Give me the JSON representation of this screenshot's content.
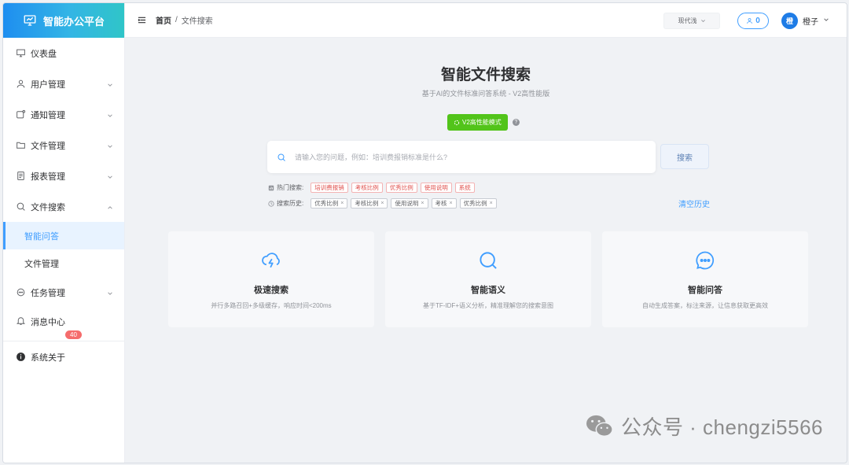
{
  "app": {
    "title": "智能办公平台"
  },
  "sidebar": {
    "items": [
      {
        "label": "仪表盘",
        "icon": "dashboard-icon"
      },
      {
        "label": "用户管理",
        "icon": "user-icon"
      },
      {
        "label": "通知管理",
        "icon": "notification-icon"
      },
      {
        "label": "文件管理",
        "icon": "folder-icon"
      },
      {
        "label": "报表管理",
        "icon": "report-icon"
      },
      {
        "label": "文件搜索",
        "icon": "search-icon"
      }
    ],
    "sub_items": [
      {
        "label": "智能问答",
        "active": true
      },
      {
        "label": "文件管理",
        "active": false
      }
    ],
    "tasks": {
      "label": "任务管理",
      "icon": "chat-icon"
    },
    "messages": {
      "label": "消息中心",
      "icon": "bell-icon",
      "badge": "40"
    },
    "about": {
      "label": "系统关于",
      "icon": "info-icon"
    }
  },
  "header": {
    "breadcrumb": {
      "home": "首页",
      "separator": "/",
      "current": "文件搜索"
    },
    "theme": "现代浅",
    "notif_count": "0",
    "user": {
      "avatar_char": "橙",
      "name": "橙子"
    }
  },
  "main": {
    "title": "智能文件搜索",
    "subtitle": "基于AI的文件标准问答系统 - V2高性能版",
    "mode_button": "V2高性能模式",
    "help": "?",
    "search": {
      "placeholder": "请输入您的问题，例如：培训费报销标准是什么?",
      "button": "搜索"
    },
    "hot": {
      "label": "热门搜索:",
      "tags": [
        "培训费报销",
        "考核比例",
        "优秀比例",
        "使用说明",
        "系统"
      ]
    },
    "history": {
      "label": "搜索历史:",
      "tags": [
        "优秀比例",
        "考核比例",
        "使用说明",
        "考核",
        "优秀比例"
      ]
    },
    "clear": "清空历史",
    "cards": [
      {
        "icon": "lightning-cloud-icon",
        "title": "极速搜索",
        "desc": "并行多路召回+多级缓存，响应时间<200ms"
      },
      {
        "icon": "magnifier-icon",
        "title": "智能语义",
        "desc": "基于TF-IDF+语义分析，精准理解您的搜索意图"
      },
      {
        "icon": "chat-bubble-icon",
        "title": "智能问答",
        "desc": "自动生成答案，标注来源，让信息获取更高效"
      }
    ]
  },
  "watermark": {
    "text": "公众号 · chengzi5566"
  },
  "colors": {
    "accent": "#409eff",
    "brand_gradient": [
      "#1e8ef0",
      "#2fc5c8"
    ],
    "green": "#52c41a",
    "badge_red": "#f56c6c"
  }
}
